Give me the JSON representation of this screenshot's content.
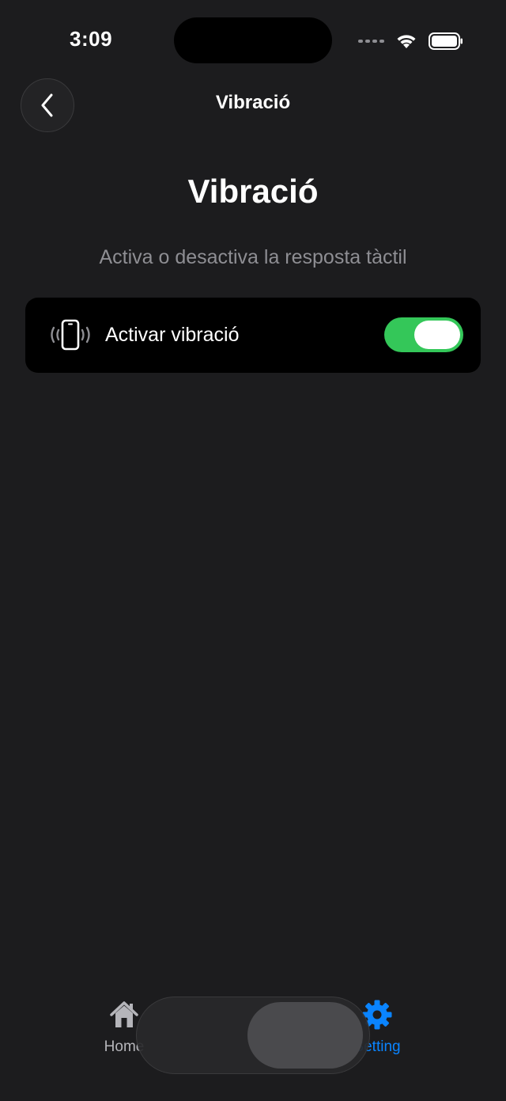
{
  "status_bar": {
    "time": "3:09"
  },
  "nav": {
    "title": "Vibració"
  },
  "main": {
    "title": "Vibració",
    "subtitle": "Activa o desactiva la resposta tàctil",
    "setting_row": {
      "label": "Activar vibració",
      "icon": "phone-vibrate-icon",
      "enabled": true
    }
  },
  "tab_bar": {
    "items": [
      {
        "label": "Home",
        "icon": "house-icon",
        "active": false
      },
      {
        "label": "Setting",
        "icon": "gear-icon",
        "active": true
      }
    ]
  },
  "colors": {
    "background": "#1c1c1e",
    "card": "#000000",
    "toggle_on": "#34c759",
    "accent": "#0a84ff",
    "secondary_text": "#8e8e93"
  }
}
